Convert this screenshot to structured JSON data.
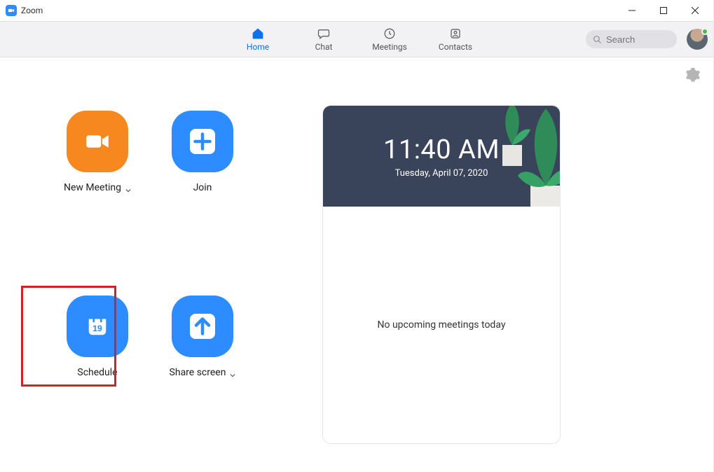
{
  "window": {
    "title": "Zoom"
  },
  "nav": {
    "tabs": [
      {
        "label": "Home"
      },
      {
        "label": "Chat"
      },
      {
        "label": "Meetings"
      },
      {
        "label": "Contacts"
      }
    ],
    "search_placeholder": "Search"
  },
  "actions": {
    "new_meeting": {
      "label": "New Meeting"
    },
    "join": {
      "label": "Join"
    },
    "schedule": {
      "label": "Schedule",
      "icon_day": "19"
    },
    "share_screen": {
      "label": "Share screen"
    }
  },
  "info": {
    "time": "11:40 AM",
    "date": "Tuesday, April 07, 2020",
    "no_meetings": "No upcoming meetings today"
  }
}
